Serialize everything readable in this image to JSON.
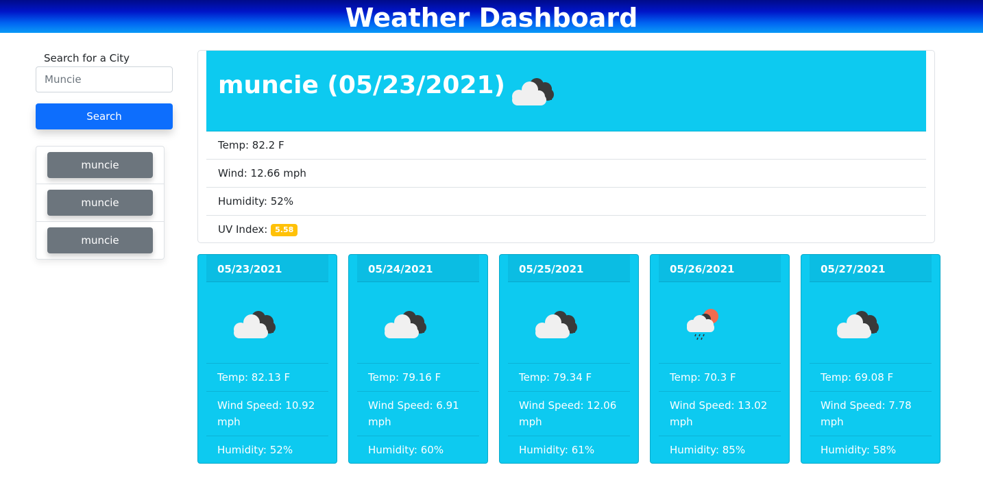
{
  "header": {
    "title": "Weather Dashboard"
  },
  "search": {
    "label": "Search for a City",
    "value": "Muncie",
    "button_label": "Search"
  },
  "history": [
    {
      "label": "muncie"
    },
    {
      "label": "muncie"
    },
    {
      "label": "muncie"
    }
  ],
  "current": {
    "title": "muncie (05/23/2021)",
    "icon": "cloud-icon",
    "temp": "Temp: 82.2 F",
    "wind": "Wind: 12.66 mph",
    "humidity": "Humidity: 52%",
    "uv_label": "UV Index:",
    "uv_value": "5.58",
    "uv_color": "#ffc107"
  },
  "forecast": [
    {
      "date": "05/23/2021",
      "icon": "cloud-icon",
      "temp": "Temp: 82.13 F",
      "wind": "Wind Speed: 10.92 mph",
      "humidity": "Humidity: 52%"
    },
    {
      "date": "05/24/2021",
      "icon": "cloud-icon",
      "temp": "Temp: 79.16 F",
      "wind": "Wind Speed: 6.91 mph",
      "humidity": "Humidity: 60%"
    },
    {
      "date": "05/25/2021",
      "icon": "cloud-icon",
      "temp": "Temp: 79.34 F",
      "wind": "Wind Speed: 12.06 mph",
      "humidity": "Humidity: 61%"
    },
    {
      "date": "05/26/2021",
      "icon": "rain-sun-icon",
      "temp": "Temp: 70.3 F",
      "wind": "Wind Speed: 13.02 mph",
      "humidity": "Humidity: 85%"
    },
    {
      "date": "05/27/2021",
      "icon": "cloud-icon",
      "temp": "Temp: 69.08 F",
      "wind": "Wind Speed: 7.78 mph",
      "humidity": "Humidity: 58%"
    }
  ],
  "colors": {
    "accent": "#0dcaf0",
    "primary_button": "#0d6efd",
    "history_button": "#6c757d"
  }
}
